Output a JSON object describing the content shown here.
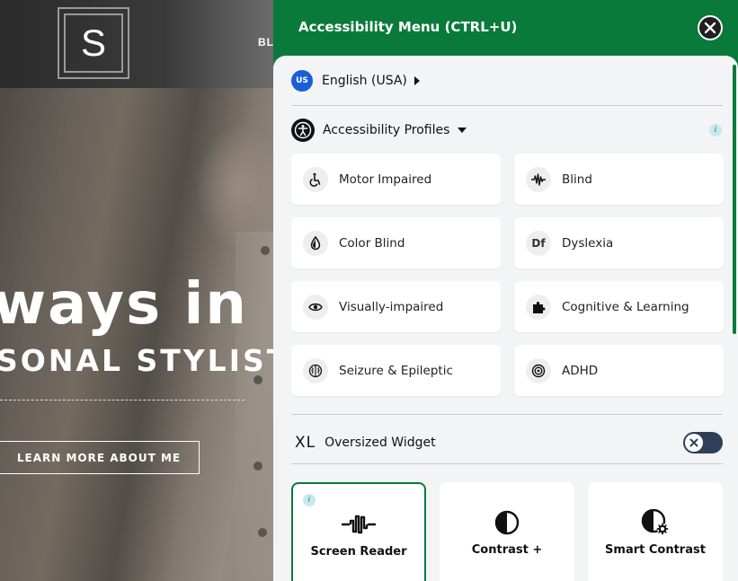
{
  "site": {
    "logo_letter": "S",
    "nav_text": "BL",
    "hero_title": "ways in",
    "hero_subtitle": "SONAL STYLIST",
    "cta_label": "LEARN MORE ABOUT ME"
  },
  "panel": {
    "title": "Accessibility Menu (CTRL+U)",
    "language": {
      "code": "US",
      "label": "English (USA)"
    },
    "profiles": {
      "label": "Accessibility Profiles",
      "items": [
        {
          "label": "Motor Impaired",
          "icon": "wheelchair-icon"
        },
        {
          "label": "Blind",
          "icon": "waveform-icon"
        },
        {
          "label": "Color Blind",
          "icon": "droplet-icon"
        },
        {
          "label": "Dyslexia",
          "icon": "df-icon",
          "icon_text": "Df"
        },
        {
          "label": "Visually-impaired",
          "icon": "eye-icon"
        },
        {
          "label": "Cognitive & Learning",
          "icon": "puzzle-icon"
        },
        {
          "label": "Seizure & Epileptic",
          "icon": "brain-icon"
        },
        {
          "label": "ADHD",
          "icon": "target-icon"
        }
      ]
    },
    "oversized": {
      "icon_text": "XL",
      "label": "Oversized Widget",
      "enabled": false
    },
    "features": [
      {
        "label": "Screen Reader",
        "icon": "screen-reader-icon",
        "active": true
      },
      {
        "label": "Contrast +",
        "icon": "contrast-icon",
        "active": false
      },
      {
        "label": "Smart Contrast",
        "icon": "smart-contrast-icon",
        "active": false
      }
    ],
    "colors": {
      "accent": "#0a7a3b",
      "body_bg": "#f3f4f6",
      "toggle_bg": "#2f3f57"
    }
  }
}
